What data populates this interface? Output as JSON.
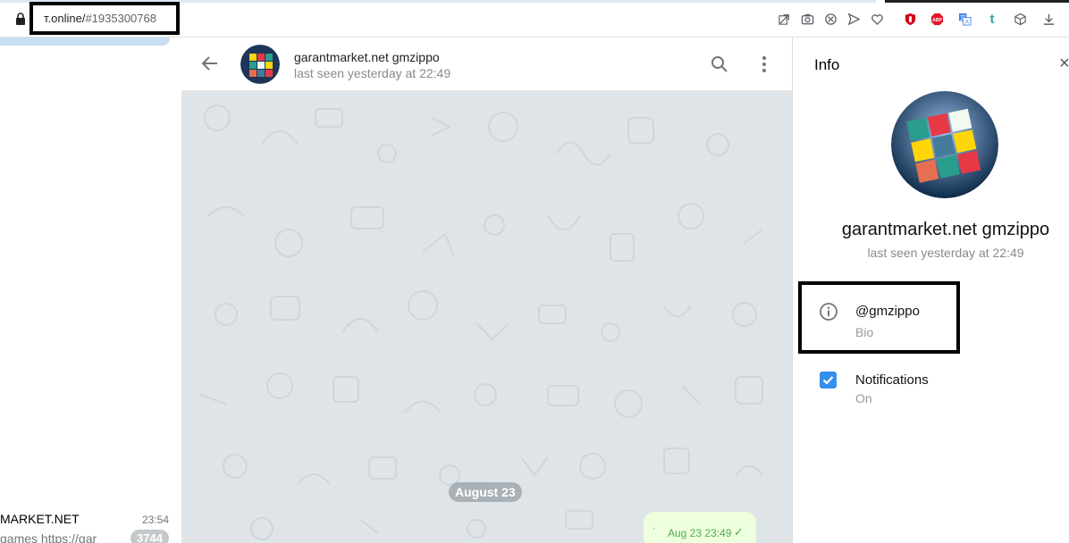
{
  "browser": {
    "url_host": "т.online/",
    "url_hash": "#1935300768"
  },
  "extensions": [
    "share-icon",
    "camera-icon",
    "block-icon",
    "send-icon",
    "heart-icon",
    "ublock-icon",
    "adblock-plus-icon",
    "translate-icon",
    "tumblr-icon",
    "cube-icon",
    "download-icon"
  ],
  "chat_list": {
    "visible_chat": {
      "name": "MARKET.NET",
      "time": "23:54",
      "preview": "games https://gar",
      "unread_count": "3744"
    }
  },
  "chat_header": {
    "name": "garantmarket.net gmzippo",
    "status": "last seen yesterday at 22:49"
  },
  "chat": {
    "date_label": "August 23",
    "message": {
      "text": "·",
      "time": "Aug 23 23:49",
      "status_mark": "✓"
    }
  },
  "info_panel": {
    "title": "Info",
    "close_glyph": "×",
    "name": "garantmarket.net gmzippo",
    "status": "last seen yesterday at 22:49",
    "username": "@gmzippo",
    "username_caption": "Bio",
    "notifications_label": "Notifications",
    "notifications_state": "On"
  },
  "colors": {
    "accent": "#3390ec",
    "chat_background": "#dfe4e8",
    "outgoing_bubble": "#eeffde",
    "read_check": "#4fae4e"
  }
}
